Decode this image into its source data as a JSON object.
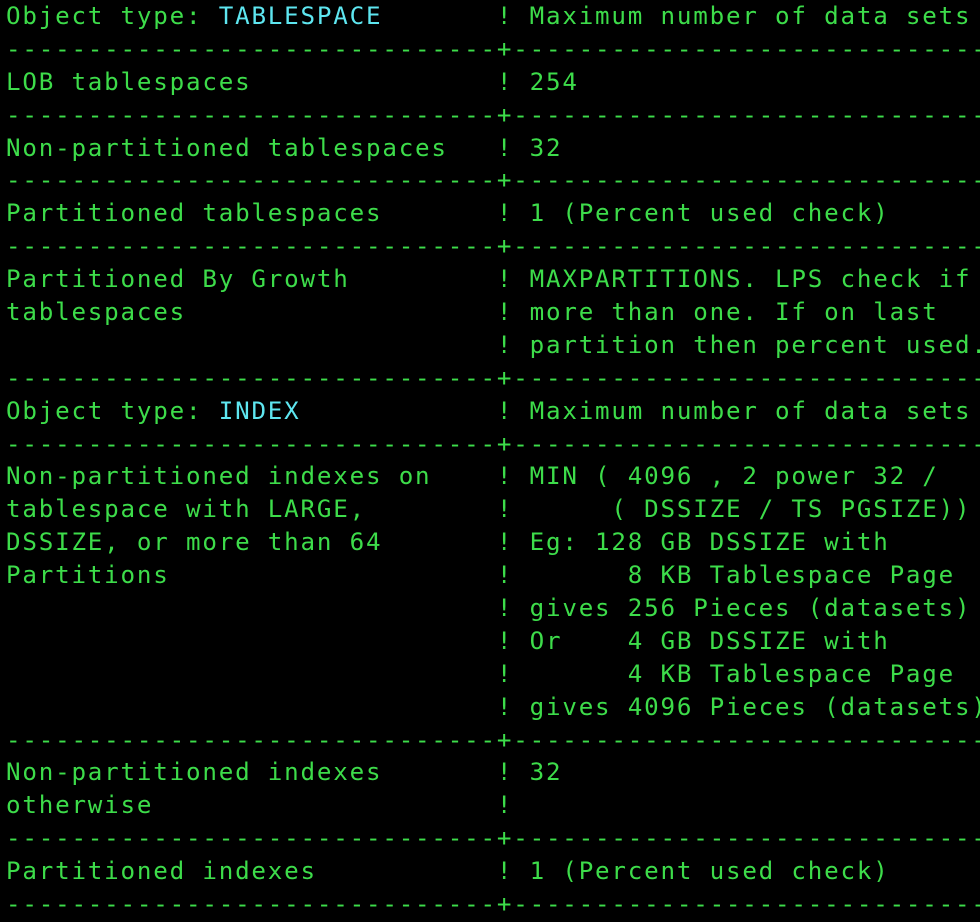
{
  "screen": {
    "colors": {
      "text": "#3ddc4a",
      "highlight": "#5ee6f0",
      "background": "#000000"
    },
    "separator": "------------------------------+-----------------------------",
    "sections": [
      {
        "header": {
          "label": "Object type: ",
          "value": "TABLESPACE",
          "right": "Maximum number of data sets"
        },
        "rows": [
          {
            "left": [
              "LOB tablespaces"
            ],
            "right": [
              "254"
            ]
          },
          {
            "left": [
              "Non-partitioned tablespaces"
            ],
            "right": [
              "32"
            ]
          },
          {
            "left": [
              "Partitioned tablespaces"
            ],
            "right": [
              "1 (Percent used check)"
            ]
          },
          {
            "left": [
              "Partitioned By Growth",
              "tablespaces",
              ""
            ],
            "right": [
              "MAXPARTITIONS. LPS check if",
              "more than one. If on last",
              "partition then percent used."
            ]
          }
        ]
      },
      {
        "header": {
          "label": "Object type: ",
          "value": "INDEX",
          "right": "Maximum number of data sets"
        },
        "rows": [
          {
            "left": [
              "Non-partitioned indexes on",
              "tablespace with LARGE,",
              "DSSIZE, or more than 64",
              "Partitions",
              "",
              "",
              "",
              ""
            ],
            "right": [
              "MIN ( 4096 , 2 power 32 /",
              "     ( DSSIZE / TS PGSIZE))",
              "Eg: 128 GB DSSIZE with",
              "      8 KB Tablespace Page",
              "gives 256 Pieces (datasets)",
              "Or    4 GB DSSIZE with",
              "      4 KB Tablespace Page",
              "gives 4096 Pieces (datasets)"
            ]
          },
          {
            "left": [
              "Non-partitioned indexes",
              "otherwise"
            ],
            "right": [
              "32",
              ""
            ]
          },
          {
            "left": [
              "Partitioned indexes"
            ],
            "right": [
              "1 (Percent used check)"
            ]
          }
        ]
      }
    ]
  }
}
